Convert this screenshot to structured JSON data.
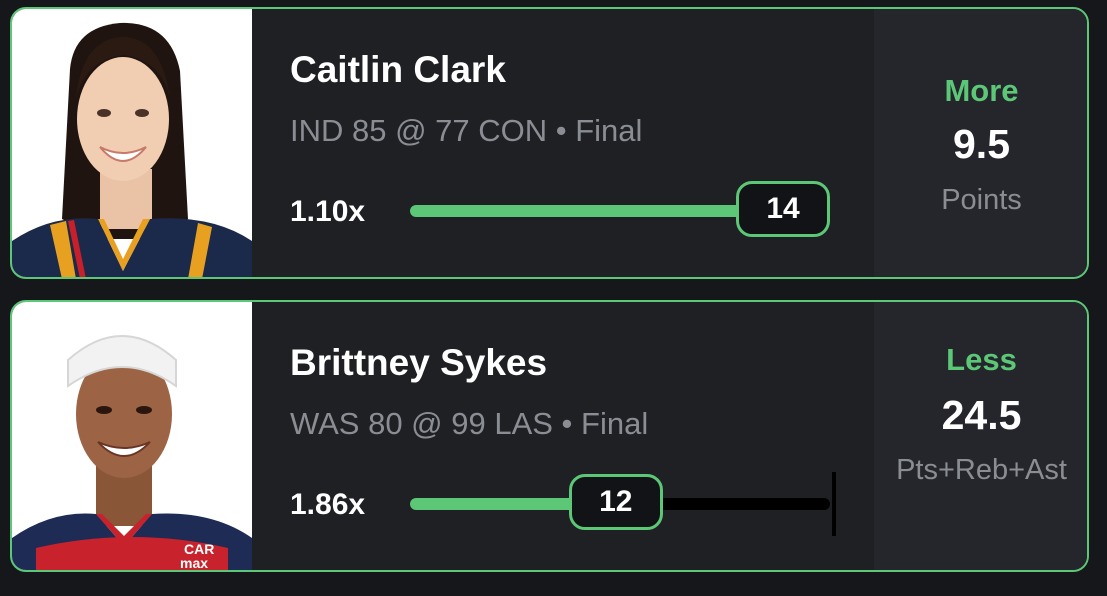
{
  "picks": [
    {
      "player": "Caitlin Clark",
      "game": "IND 85 @ 77 CON • Final",
      "multiplier": "1.10x",
      "current_stat": "14",
      "progress_fraction": 1.0,
      "pick": "More",
      "line": "9.5",
      "stat_type": "Points"
    },
    {
      "player": "Brittney Sykes",
      "game": "WAS 80 @ 99 LAS • Final",
      "multiplier": "1.86x",
      "current_stat": "12",
      "progress_fraction": 0.49,
      "pick": "Less",
      "line": "24.5",
      "stat_type": "Pts+Reb+Ast"
    }
  ],
  "colors": {
    "accent": "#5cc777",
    "card_background": "#1e2024",
    "panel_background": "#24262b",
    "muted_text": "#8a8d93"
  }
}
